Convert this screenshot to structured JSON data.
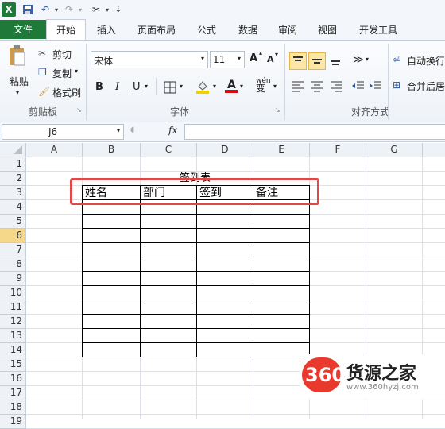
{
  "qat": {
    "app_icon": "excel-icon",
    "save_icon": "save-icon",
    "undo_icon": "undo-icon",
    "redo_icon": "redo-icon",
    "tools_icon": "tools-icon"
  },
  "tabs": [
    "文件",
    "开始",
    "插入",
    "页面布局",
    "公式",
    "数据",
    "审阅",
    "视图",
    "开发工具"
  ],
  "clipboard": {
    "paste": "粘贴",
    "cut": "剪切",
    "copy": "复制",
    "format_painter": "格式刷",
    "group": "剪贴板"
  },
  "font": {
    "name": "宋体",
    "size": "11",
    "grow": "A",
    "shrink": "A",
    "bold": "B",
    "italic": "I",
    "underline": "U",
    "wen": "wén",
    "wen_sub": "变",
    "group": "字体",
    "font_color": "#d01010",
    "fill_color": "#f0d000"
  },
  "alignment": {
    "wrap": "自动换行",
    "merge": "合并后居",
    "group": "对齐方式"
  },
  "formula_bar": {
    "name_box": "J6",
    "fx": "fx",
    "content": ""
  },
  "columns": [
    "A",
    "B",
    "C",
    "D",
    "E",
    "F",
    "G"
  ],
  "rows": [
    "1",
    "2",
    "3",
    "4",
    "5",
    "6",
    "7",
    "8",
    "9",
    "10",
    "11",
    "12",
    "13",
    "14",
    "15",
    "16",
    "17",
    "18",
    "19"
  ],
  "active_row": "6",
  "sheet": {
    "title": "签到表",
    "headers": [
      "姓名",
      "部门",
      "签到",
      "备注"
    ]
  },
  "watermark": {
    "logo": "360",
    "name": "货源之家",
    "url": "www.360hyzj.com"
  }
}
